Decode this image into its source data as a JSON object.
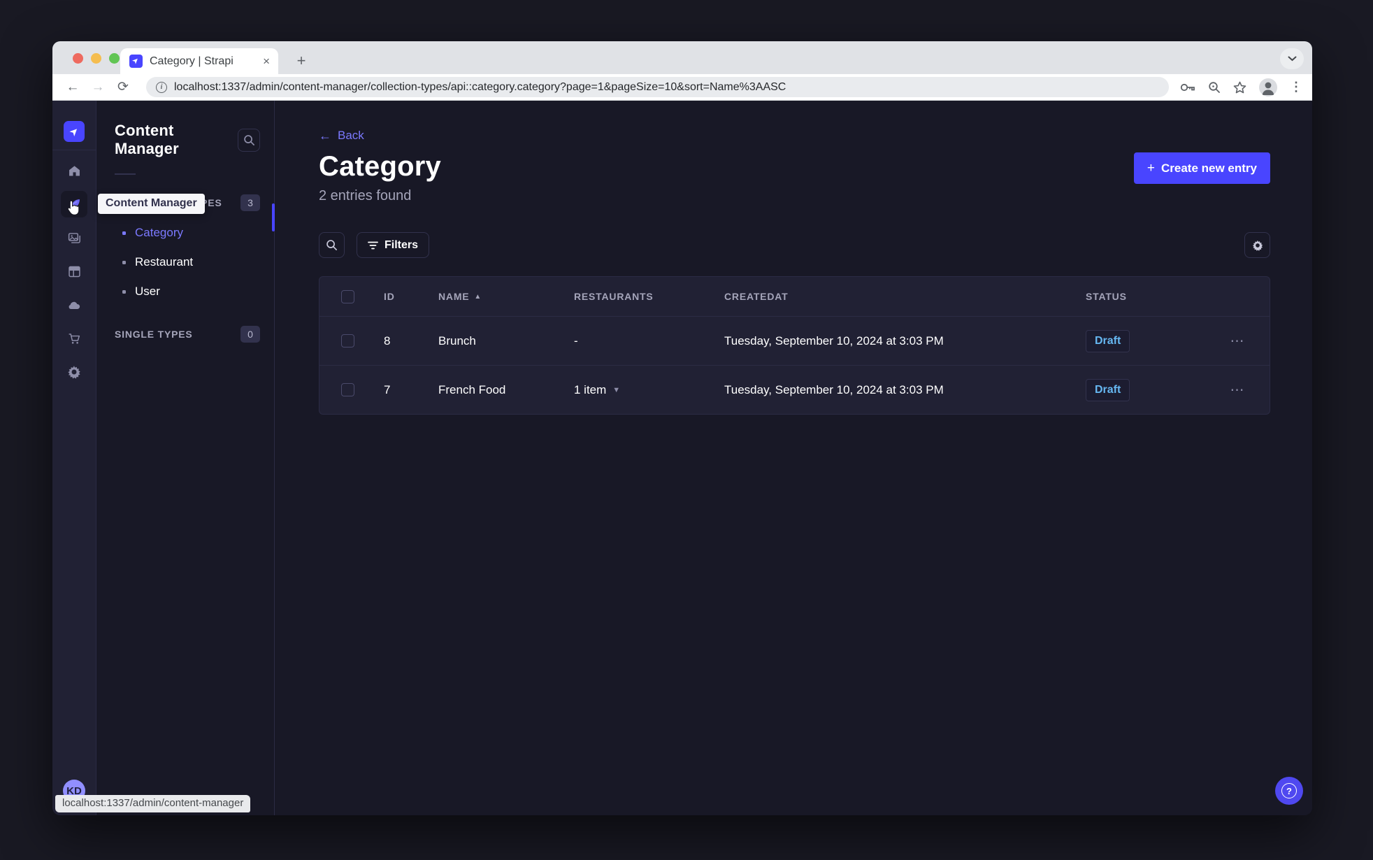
{
  "colors": {
    "accent": "#4945ff",
    "accent_light": "#7b79ff",
    "draft_status": "#66b7f1"
  },
  "browser": {
    "tab_title": "Category | Strapi",
    "url": "localhost:1337/admin/content-manager/collection-types/api::category.category?page=1&pageSize=10&sort=Name%3AASC",
    "status_bar": "localhost:1337/admin/content-manager"
  },
  "sidebar": {
    "avatar_initials": "KD",
    "tooltip": "Content Manager",
    "items": [
      {
        "name": "home"
      },
      {
        "name": "content-manager",
        "active": true
      },
      {
        "name": "media-library"
      },
      {
        "name": "content-type-builder"
      },
      {
        "name": "cloud"
      },
      {
        "name": "marketplace"
      },
      {
        "name": "settings"
      }
    ]
  },
  "subnav": {
    "title": "Content Manager",
    "sections": [
      {
        "label": "COLLECTION TYPES",
        "badge": "3",
        "items": [
          {
            "label": "Category",
            "active": true
          },
          {
            "label": "Restaurant"
          },
          {
            "label": "User"
          }
        ]
      },
      {
        "label": "SINGLE TYPES",
        "badge": "0",
        "items": []
      }
    ]
  },
  "main": {
    "back_label": "Back",
    "title": "Category",
    "subtitle": "2 entries found",
    "create_button_label": "Create new entry",
    "filters_label": "Filters",
    "table": {
      "headers": [
        "ID",
        "NAME",
        "RESTAURANTS",
        "CREATEDAT",
        "STATUS"
      ],
      "sorted_by": "NAME",
      "rows": [
        {
          "id": "8",
          "name": "Brunch",
          "restaurants": "-",
          "createdat": "Tuesday, September 10, 2024 at 3:03 PM",
          "status": "Draft"
        },
        {
          "id": "7",
          "name": "French Food",
          "restaurants": "1 item",
          "createdat": "Tuesday, September 10, 2024 at 3:03 PM",
          "status": "Draft"
        }
      ]
    }
  }
}
